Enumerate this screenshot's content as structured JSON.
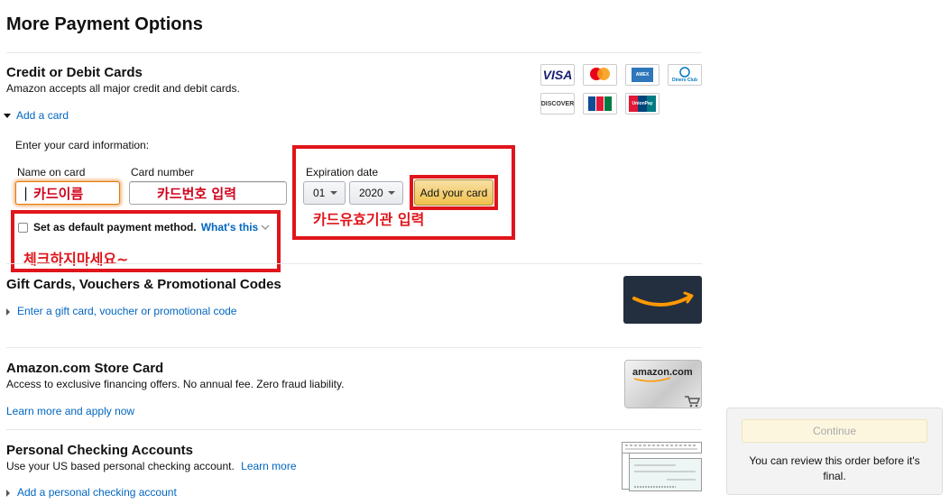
{
  "page": {
    "title": "More Payment Options"
  },
  "credit_cards": {
    "title": "Credit or Debit Cards",
    "description": "Amazon accepts all major credit and debit cards.",
    "add_card_link": "Add a card",
    "form_intro": "Enter your card information:",
    "name_label": "Name on card",
    "name_value": "카드이름",
    "number_label": "Card number",
    "number_value": "카드번호 입력",
    "expiration_label": "Expiration date",
    "month_value": "01",
    "year_value": "2020",
    "add_button": "Add your card",
    "default_checkbox_label": "Set as default payment method.",
    "whats_this_link": "What's this",
    "logos": [
      "VISA",
      "Mastercard",
      "AMEX",
      "Diners Club",
      "DISCOVER",
      "JCB",
      "UnionPay"
    ]
  },
  "annotations": {
    "expiration_note": "카드유효기관 입력",
    "checkbox_note": "체크하지마세요~"
  },
  "gift_cards": {
    "title": "Gift Cards, Vouchers & Promotional Codes",
    "link": "Enter a gift card, voucher or promotional code"
  },
  "store_card": {
    "title": "Amazon.com Store Card",
    "description": "Access to exclusive financing offers. No annual fee. Zero fraud liability.",
    "link": "Learn more and apply now",
    "card_brand": "amazon.com"
  },
  "checking": {
    "title": "Personal Checking Accounts",
    "description": "Use your US based personal checking account.",
    "learn_more": "Learn more",
    "add_link": "Add a personal checking account"
  },
  "order_panel": {
    "continue_button": "Continue",
    "note": "You can review this order before it's final."
  },
  "colors": {
    "link": "#0066c0",
    "annotation_red": "#e0151b",
    "button_yellow": "#f0c14b",
    "amazon_dark": "#232f3e",
    "amazon_orange": "#ff9900"
  }
}
